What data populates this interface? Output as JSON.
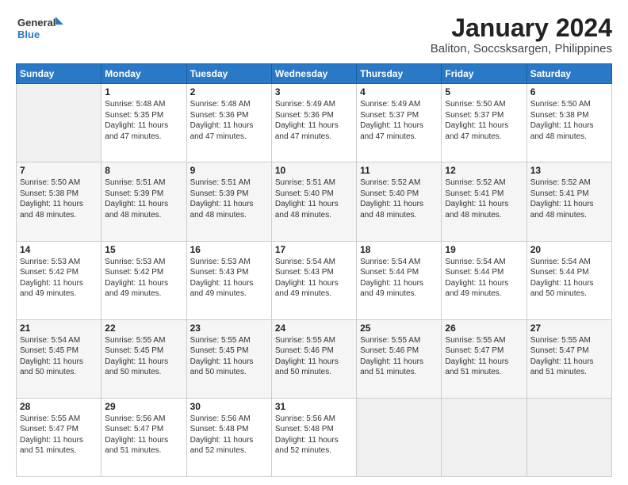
{
  "header": {
    "logo_line1": "General",
    "logo_line2": "Blue",
    "title": "January 2024",
    "subtitle": "Baliton, Soccsksargen, Philippines"
  },
  "weekdays": [
    "Sunday",
    "Monday",
    "Tuesday",
    "Wednesday",
    "Thursday",
    "Friday",
    "Saturday"
  ],
  "weeks": [
    [
      {
        "day": "",
        "info": ""
      },
      {
        "day": "1",
        "info": "Sunrise: 5:48 AM\nSunset: 5:35 PM\nDaylight: 11 hours\nand 47 minutes."
      },
      {
        "day": "2",
        "info": "Sunrise: 5:48 AM\nSunset: 5:36 PM\nDaylight: 11 hours\nand 47 minutes."
      },
      {
        "day": "3",
        "info": "Sunrise: 5:49 AM\nSunset: 5:36 PM\nDaylight: 11 hours\nand 47 minutes."
      },
      {
        "day": "4",
        "info": "Sunrise: 5:49 AM\nSunset: 5:37 PM\nDaylight: 11 hours\nand 47 minutes."
      },
      {
        "day": "5",
        "info": "Sunrise: 5:50 AM\nSunset: 5:37 PM\nDaylight: 11 hours\nand 47 minutes."
      },
      {
        "day": "6",
        "info": "Sunrise: 5:50 AM\nSunset: 5:38 PM\nDaylight: 11 hours\nand 48 minutes."
      }
    ],
    [
      {
        "day": "7",
        "info": "Sunrise: 5:50 AM\nSunset: 5:38 PM\nDaylight: 11 hours\nand 48 minutes."
      },
      {
        "day": "8",
        "info": "Sunrise: 5:51 AM\nSunset: 5:39 PM\nDaylight: 11 hours\nand 48 minutes."
      },
      {
        "day": "9",
        "info": "Sunrise: 5:51 AM\nSunset: 5:39 PM\nDaylight: 11 hours\nand 48 minutes."
      },
      {
        "day": "10",
        "info": "Sunrise: 5:51 AM\nSunset: 5:40 PM\nDaylight: 11 hours\nand 48 minutes."
      },
      {
        "day": "11",
        "info": "Sunrise: 5:52 AM\nSunset: 5:40 PM\nDaylight: 11 hours\nand 48 minutes."
      },
      {
        "day": "12",
        "info": "Sunrise: 5:52 AM\nSunset: 5:41 PM\nDaylight: 11 hours\nand 48 minutes."
      },
      {
        "day": "13",
        "info": "Sunrise: 5:52 AM\nSunset: 5:41 PM\nDaylight: 11 hours\nand 48 minutes."
      }
    ],
    [
      {
        "day": "14",
        "info": "Sunrise: 5:53 AM\nSunset: 5:42 PM\nDaylight: 11 hours\nand 49 minutes."
      },
      {
        "day": "15",
        "info": "Sunrise: 5:53 AM\nSunset: 5:42 PM\nDaylight: 11 hours\nand 49 minutes."
      },
      {
        "day": "16",
        "info": "Sunrise: 5:53 AM\nSunset: 5:43 PM\nDaylight: 11 hours\nand 49 minutes."
      },
      {
        "day": "17",
        "info": "Sunrise: 5:54 AM\nSunset: 5:43 PM\nDaylight: 11 hours\nand 49 minutes."
      },
      {
        "day": "18",
        "info": "Sunrise: 5:54 AM\nSunset: 5:44 PM\nDaylight: 11 hours\nand 49 minutes."
      },
      {
        "day": "19",
        "info": "Sunrise: 5:54 AM\nSunset: 5:44 PM\nDaylight: 11 hours\nand 49 minutes."
      },
      {
        "day": "20",
        "info": "Sunrise: 5:54 AM\nSunset: 5:44 PM\nDaylight: 11 hours\nand 50 minutes."
      }
    ],
    [
      {
        "day": "21",
        "info": "Sunrise: 5:54 AM\nSunset: 5:45 PM\nDaylight: 11 hours\nand 50 minutes."
      },
      {
        "day": "22",
        "info": "Sunrise: 5:55 AM\nSunset: 5:45 PM\nDaylight: 11 hours\nand 50 minutes."
      },
      {
        "day": "23",
        "info": "Sunrise: 5:55 AM\nSunset: 5:45 PM\nDaylight: 11 hours\nand 50 minutes."
      },
      {
        "day": "24",
        "info": "Sunrise: 5:55 AM\nSunset: 5:46 PM\nDaylight: 11 hours\nand 50 minutes."
      },
      {
        "day": "25",
        "info": "Sunrise: 5:55 AM\nSunset: 5:46 PM\nDaylight: 11 hours\nand 51 minutes."
      },
      {
        "day": "26",
        "info": "Sunrise: 5:55 AM\nSunset: 5:47 PM\nDaylight: 11 hours\nand 51 minutes."
      },
      {
        "day": "27",
        "info": "Sunrise: 5:55 AM\nSunset: 5:47 PM\nDaylight: 11 hours\nand 51 minutes."
      }
    ],
    [
      {
        "day": "28",
        "info": "Sunrise: 5:55 AM\nSunset: 5:47 PM\nDaylight: 11 hours\nand 51 minutes."
      },
      {
        "day": "29",
        "info": "Sunrise: 5:56 AM\nSunset: 5:47 PM\nDaylight: 11 hours\nand 51 minutes."
      },
      {
        "day": "30",
        "info": "Sunrise: 5:56 AM\nSunset: 5:48 PM\nDaylight: 11 hours\nand 52 minutes."
      },
      {
        "day": "31",
        "info": "Sunrise: 5:56 AM\nSunset: 5:48 PM\nDaylight: 11 hours\nand 52 minutes."
      },
      {
        "day": "",
        "info": ""
      },
      {
        "day": "",
        "info": ""
      },
      {
        "day": "",
        "info": ""
      }
    ]
  ]
}
